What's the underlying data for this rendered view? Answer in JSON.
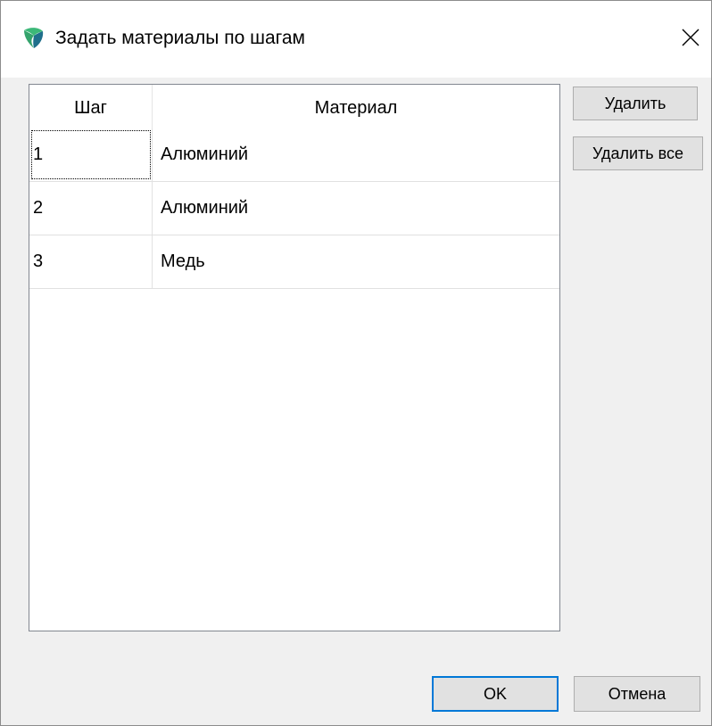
{
  "window": {
    "title": "Задать материалы по шагам",
    "icon": "app-logo-icon",
    "close_icon": "close-icon"
  },
  "table": {
    "headers": {
      "step": "Шаг",
      "material": "Материал"
    },
    "rows": [
      {
        "step": "1",
        "material": "Алюминий"
      },
      {
        "step": "2",
        "material": "Алюминий"
      },
      {
        "step": "3",
        "material": "Медь"
      }
    ],
    "focused_row": 0
  },
  "buttons": {
    "delete": "Удалить",
    "delete_all": "Удалить все",
    "ok": "OK",
    "cancel": "Отмена"
  },
  "colors": {
    "accent": "#0078d7",
    "logo_green": "#3cb878",
    "logo_teal": "#1f6f8b"
  }
}
